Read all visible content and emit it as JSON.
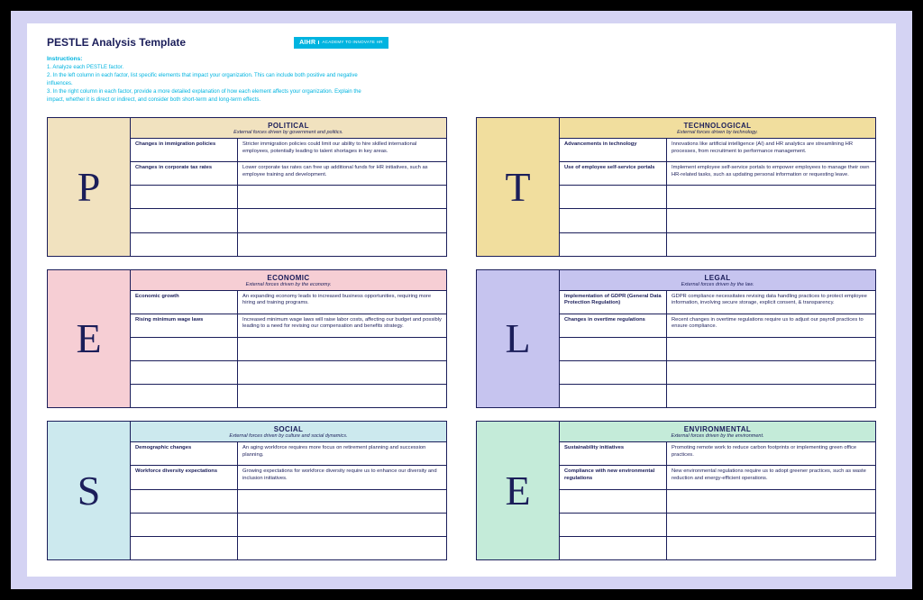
{
  "title": "PESTLE Analysis Template",
  "logo": {
    "main": "AIHR",
    "sub": "ACADEMY TO\nINNOVATE HR"
  },
  "instructions_label": "Instructions:",
  "instructions": [
    "1. Analyze each PESTLE factor.",
    "2. In the left column in each factor, list specific elements that impact your organization. This can include both positive and negative influences.",
    "3. In the right column in each factor, provide a more detailed explanation of how each element affects your organization. Explain the impact, whether it is direct or indirect, and consider both short-term and long-term effects."
  ],
  "factors": [
    {
      "letter": "P",
      "name": "POLITICAL",
      "subtitle": "External forces driven by government and politics.",
      "color": "var(--p-color)",
      "rows": [
        {
          "element": "Changes in immigration policies",
          "desc": "Stricter immigration policies could limit our ability to hire skilled international employees, potentially leading to talent shortages in key areas."
        },
        {
          "element": "Changes in corporate tax rates",
          "desc": "Lower corporate tax rates can free up additional funds for HR initiatives, such as employee training and development."
        },
        {
          "element": "",
          "desc": ""
        },
        {
          "element": "",
          "desc": ""
        },
        {
          "element": "",
          "desc": ""
        }
      ]
    },
    {
      "letter": "T",
      "name": "TECHNOLOGICAL",
      "subtitle": "External forces driven by technology.",
      "color": "var(--t-color)",
      "rows": [
        {
          "element": "Advancements in technology",
          "desc": "Innovations like artificial intelligence (AI) and HR analytics are streamlining HR processes, from recruitment to performance management."
        },
        {
          "element": "Use of employee self-service portals",
          "desc": "Implement employee self-service portals to empower employees to manage their own HR-related tasks, such as updating personal information or requesting leave."
        },
        {
          "element": "",
          "desc": ""
        },
        {
          "element": "",
          "desc": ""
        },
        {
          "element": "",
          "desc": ""
        }
      ]
    },
    {
      "letter": "E",
      "name": "ECONOMIC",
      "subtitle": "External forces driven by the economy.",
      "color": "var(--e-color)",
      "rows": [
        {
          "element": "Economic growth",
          "desc": "An expanding economy leads to increased business opportunities, requiring more hiring and training programs."
        },
        {
          "element": "Rising minimum wage laws",
          "desc": "Increased minimum wage laws will raise labor costs, affecting our budget and possibly leading to a need for revising our compensation and benefits strategy."
        },
        {
          "element": "",
          "desc": ""
        },
        {
          "element": "",
          "desc": ""
        },
        {
          "element": "",
          "desc": ""
        }
      ]
    },
    {
      "letter": "L",
      "name": "LEGAL",
      "subtitle": "External forces driven by the law.",
      "color": "var(--l-color)",
      "rows": [
        {
          "element": "Implementation of GDPR (General Data Protection Regulation)",
          "desc": "GDPR compliance necessitates revising data handling practices to protect employee information, involving secure storage, explicit consent, & transparency."
        },
        {
          "element": "Changes in overtime regulations",
          "desc": "Recent changes in overtime regulations require us to adjust our payroll practices to ensure compliance."
        },
        {
          "element": "",
          "desc": ""
        },
        {
          "element": "",
          "desc": ""
        },
        {
          "element": "",
          "desc": ""
        }
      ]
    },
    {
      "letter": "S",
      "name": "SOCIAL",
      "subtitle": "External forces driven by culture and social dynamics.",
      "color": "var(--s-color)",
      "rows": [
        {
          "element": "Demographic changes",
          "desc": "An aging workforce requires more focus on retirement planning and succession planning."
        },
        {
          "element": "Workforce diversity expectations",
          "desc": "Growing expectations for workforce diversity require us to enhance our diversity and inclusion initiatives."
        },
        {
          "element": "",
          "desc": ""
        },
        {
          "element": "",
          "desc": ""
        },
        {
          "element": "",
          "desc": ""
        }
      ]
    },
    {
      "letter": "E",
      "name": "ENVIRONMENTAL",
      "subtitle": "External forces driven by the environment.",
      "color": "var(--en-color)",
      "rows": [
        {
          "element": "Sustainability initiatives",
          "desc": "Promoting remote work to reduce carbon footprints or implementing green office practices."
        },
        {
          "element": "Compliance with new environmental regulations",
          "desc": "New environmental regulations require us to adopt greener practices, such as waste reduction and energy-efficient operations."
        },
        {
          "element": "",
          "desc": ""
        },
        {
          "element": "",
          "desc": ""
        },
        {
          "element": "",
          "desc": ""
        }
      ]
    }
  ]
}
